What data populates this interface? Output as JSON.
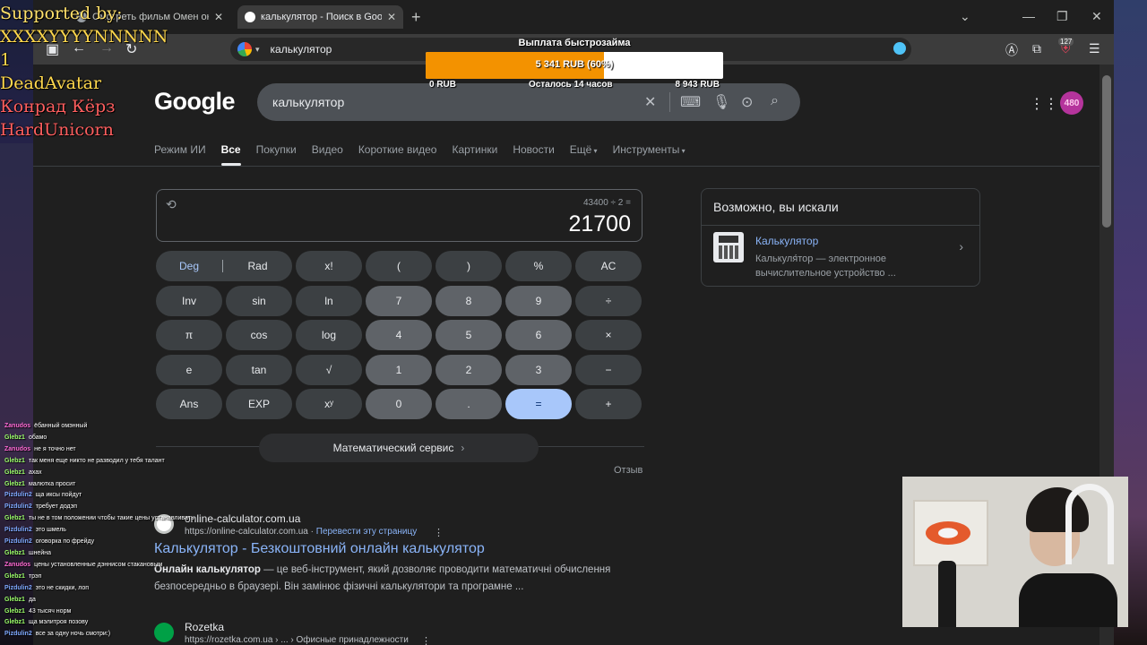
{
  "overlay": {
    "supporters": {
      "heading": "Supported by:",
      "names": [
        "XXXXYYYYNNNNN",
        "1",
        "DeadAvatar",
        "Конрад Кёрз",
        "HardUnicorn"
      ]
    },
    "donation": {
      "title": "Выплата быстрозайма",
      "amount": "5 341 RUB (60%)",
      "progress_fraction": 0.6,
      "min": "0 RUB",
      "remaining": "Осталось 14 часов",
      "max": "8 943 RUB"
    },
    "chat": [
      {
        "user": "Zanudos",
        "color": "#ff6ad5",
        "text": "ёбанный омэнный"
      },
      {
        "user": "Glebz1",
        "color": "#9cff6a",
        "text": "обамо"
      },
      {
        "user": "Zanudos",
        "color": "#ff6ad5",
        "text": "не я точно нет"
      },
      {
        "user": "Glebz1",
        "color": "#9cff6a",
        "text": "так меня еще никто не разводил у тебя талант"
      },
      {
        "user": "Glebz1",
        "color": "#9cff6a",
        "text": "ахах"
      },
      {
        "user": "Glebz1",
        "color": "#9cff6a",
        "text": "малютка просит"
      },
      {
        "user": "Pizdulin2",
        "color": "#7fa9ff",
        "text": "ща иксы пойдут"
      },
      {
        "user": "Pizdulin2",
        "color": "#7fa9ff",
        "text": "требует додэп"
      },
      {
        "user": "Glebz1",
        "color": "#9cff6a",
        "text": "ты не в том положении чтобы такие цены устанавливать"
      },
      {
        "user": "Pizdulin2",
        "color": "#7fa9ff",
        "text": "это шмель"
      },
      {
        "user": "Pizdulin2",
        "color": "#7fa9ff",
        "text": "оговорка по фрейду"
      },
      {
        "user": "Glebz1",
        "color": "#9cff6a",
        "text": "шнейна"
      },
      {
        "user": "Zanudos",
        "color": "#ff6ad5",
        "text": "цены установленные дэннисом стакановым"
      },
      {
        "user": "Glebz1",
        "color": "#9cff6a",
        "text": "трэп"
      },
      {
        "user": "Pizdulin2",
        "color": "#7fa9ff",
        "text": "это не скидки, лоп"
      },
      {
        "user": "Glebz1",
        "color": "#9cff6a",
        "text": "да"
      },
      {
        "user": "Glebz1",
        "color": "#9cff6a",
        "text": "43 тысяч норм"
      },
      {
        "user": "Glebz1",
        "color": "#9cff6a",
        "text": "ща мэлитроя позову"
      },
      {
        "user": "Pizdulin2",
        "color": "#7fa9ff",
        "text": "все за одну ночь смотри:)"
      }
    ]
  },
  "browser": {
    "tabs": [
      {
        "title": "Смотреть фильм Омен онлайн"
      },
      {
        "title": "калькулятор - Поиск в Google"
      }
    ],
    "address": "калькулятор",
    "extension_badge": "127"
  },
  "google": {
    "logo": "Google",
    "query": "калькулятор",
    "avatar_text": "480",
    "tabs": [
      "Режим ИИ",
      "Все",
      "Покупки",
      "Видео",
      "Короткие видео",
      "Картинки",
      "Новости",
      "Ещё",
      "Инструменты"
    ],
    "selected_tab": "Все",
    "calculator": {
      "expression": "43400 ÷ 2 =",
      "result": "21700",
      "keys": [
        [
          "Deg",
          "Rad",
          "x!",
          "(",
          ")",
          "%",
          "AC"
        ],
        [
          "Inv",
          "sin",
          "ln",
          "7",
          "8",
          "9",
          "÷"
        ],
        [
          "π",
          "cos",
          "log",
          "4",
          "5",
          "6",
          "×"
        ],
        [
          "e",
          "tan",
          "√",
          "1",
          "2",
          "3",
          "−"
        ],
        [
          "Ans",
          "EXP",
          "xʸ",
          "0",
          ".",
          "=",
          "+"
        ]
      ],
      "math_service": "Математический сервис",
      "feedback": "Отзыв"
    },
    "related": {
      "heading": "Возможно, вы искали",
      "title": "Калькулятор",
      "description": "Калькуля́тор — электронное вычислительное устройство ..."
    },
    "results": [
      {
        "site": "online-calculator.com.ua",
        "url": "https://online-calculator.com.ua",
        "translate": "Перевести эту страницу",
        "title": "Калькулятор - Безкоштовний онлайн калькулятор",
        "snippet_bold": "Онлайн калькулятор",
        "snippet": " — це веб-інструмент, який дозволяє проводити математичні обчислення безпосередньо в браузері. Він замінює фізичні калькулятори та програмне ..."
      },
      {
        "site": "Rozetka",
        "url": "https://rozetka.com.ua › ... › Офисные принадлежности"
      }
    ]
  }
}
